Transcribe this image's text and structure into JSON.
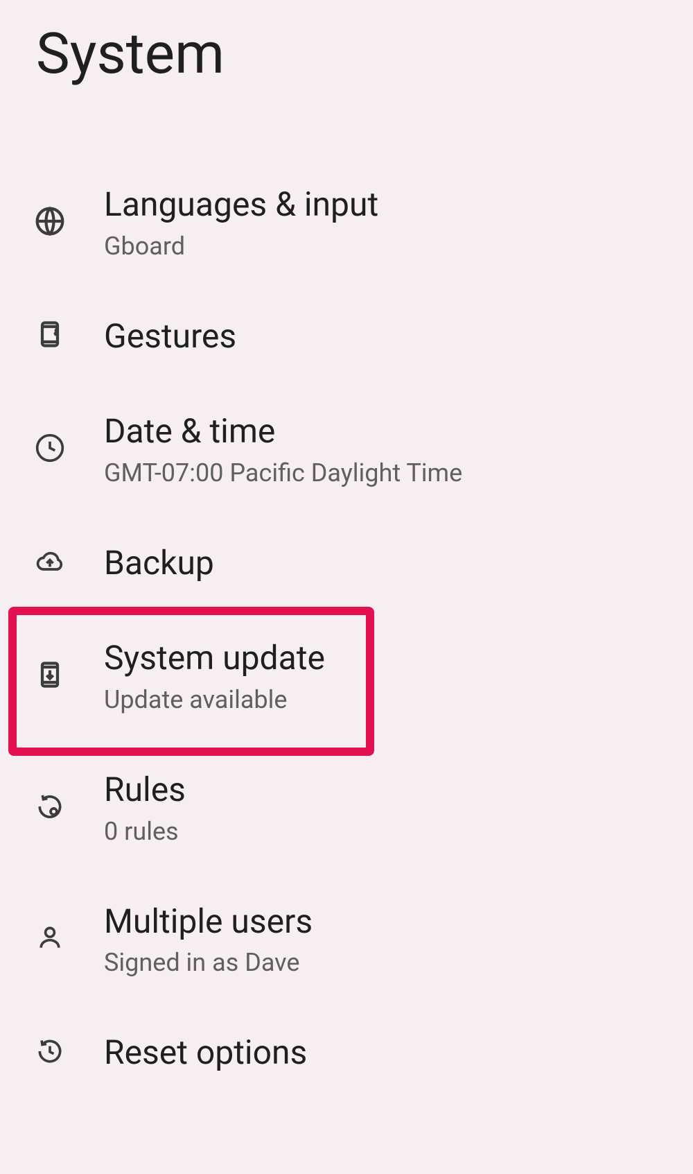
{
  "header": {
    "title": "System"
  },
  "items": [
    {
      "title": "Languages & input",
      "subtitle": "Gboard"
    },
    {
      "title": "Gestures",
      "subtitle": null
    },
    {
      "title": "Date & time",
      "subtitle": "GMT-07:00 Pacific Daylight Time"
    },
    {
      "title": "Backup",
      "subtitle": null
    },
    {
      "title": "System update",
      "subtitle": "Update available",
      "highlighted": true
    },
    {
      "title": "Rules",
      "subtitle": "0 rules"
    },
    {
      "title": "Multiple users",
      "subtitle": "Signed in as Dave"
    },
    {
      "title": "Reset options",
      "subtitle": null
    }
  ]
}
